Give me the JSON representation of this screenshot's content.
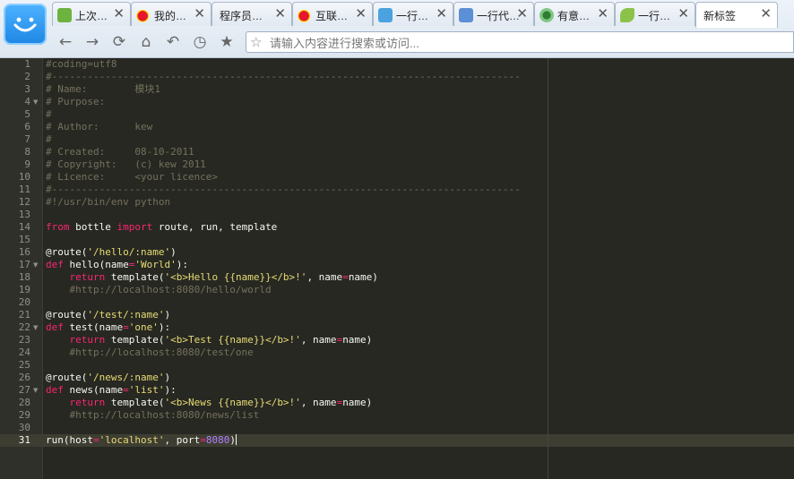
{
  "colors": {
    "keyword": "#f92672",
    "string": "#e6db74",
    "comment": "#75715e",
    "number": "#ae81ff",
    "plain": "#f8f8f2",
    "background": "#272822"
  },
  "browser": {
    "tabs": [
      {
        "label": "上次…",
        "icon": "history-icon",
        "active": false
      },
      {
        "label": "我的…",
        "icon": "weibo-icon",
        "active": false
      },
      {
        "label": "程序员…",
        "icon": "none",
        "active": false
      },
      {
        "label": "互联…",
        "icon": "weibo-icon",
        "active": false
      },
      {
        "label": "一行…",
        "icon": "b-icon",
        "active": false
      },
      {
        "label": "一行代…",
        "icon": "home-icon",
        "active": false
      },
      {
        "label": "有意…",
        "icon": "c-icon",
        "active": false
      },
      {
        "label": "一行…",
        "icon": "leaf-icon",
        "active": false
      },
      {
        "label": "新标签",
        "icon": "none",
        "active": true
      }
    ],
    "address_placeholder": "请输入内容进行搜索或访问..."
  },
  "editor": {
    "current_line": "31",
    "lines": [
      {
        "n": "1",
        "fold": false,
        "t": [
          [
            "c",
            "#coding=utf8"
          ]
        ]
      },
      {
        "n": "2",
        "fold": false,
        "t": [
          [
            "c",
            "#-------------------------------------------------------------------------------"
          ]
        ]
      },
      {
        "n": "3",
        "fold": false,
        "t": [
          [
            "c",
            "# Name:        模块1"
          ]
        ]
      },
      {
        "n": "4",
        "fold": true,
        "t": [
          [
            "c",
            "# Purpose:"
          ]
        ]
      },
      {
        "n": "5",
        "fold": false,
        "t": [
          [
            "c",
            "#"
          ]
        ]
      },
      {
        "n": "6",
        "fold": false,
        "t": [
          [
            "c",
            "# Author:      kew"
          ]
        ]
      },
      {
        "n": "7",
        "fold": false,
        "t": [
          [
            "c",
            "#"
          ]
        ]
      },
      {
        "n": "8",
        "fold": false,
        "t": [
          [
            "c",
            "# Created:     08-10-2011"
          ]
        ]
      },
      {
        "n": "9",
        "fold": false,
        "t": [
          [
            "c",
            "# Copyright:   (c) kew 2011"
          ]
        ]
      },
      {
        "n": "10",
        "fold": false,
        "t": [
          [
            "c",
            "# Licence:     <your licence>"
          ]
        ]
      },
      {
        "n": "11",
        "fold": false,
        "t": [
          [
            "c",
            "#-------------------------------------------------------------------------------"
          ]
        ]
      },
      {
        "n": "12",
        "fold": false,
        "t": [
          [
            "c",
            "#!/usr/bin/env python"
          ]
        ]
      },
      {
        "n": "13",
        "fold": false,
        "t": []
      },
      {
        "n": "14",
        "fold": false,
        "t": [
          [
            "k",
            "from"
          ],
          [
            "p",
            " bottle "
          ],
          [
            "k",
            "import"
          ],
          [
            "p",
            " route, run, template"
          ]
        ]
      },
      {
        "n": "15",
        "fold": false,
        "t": []
      },
      {
        "n": "16",
        "fold": false,
        "t": [
          [
            "p",
            "@route("
          ],
          [
            "s",
            "'/hello/:name'"
          ],
          [
            "p",
            ")"
          ]
        ]
      },
      {
        "n": "17",
        "fold": true,
        "t": [
          [
            "k",
            "def"
          ],
          [
            "p",
            " hello(name"
          ],
          [
            "k",
            "="
          ],
          [
            "s",
            "'World'"
          ],
          [
            "p",
            "):"
          ]
        ]
      },
      {
        "n": "18",
        "fold": false,
        "t": [
          [
            "p",
            "    "
          ],
          [
            "k",
            "return"
          ],
          [
            "p",
            " template("
          ],
          [
            "s",
            "'<b>Hello {{name}}</b>!'"
          ],
          [
            "p",
            ", name"
          ],
          [
            "k",
            "="
          ],
          [
            "p",
            "name)"
          ]
        ]
      },
      {
        "n": "19",
        "fold": false,
        "t": [
          [
            "p",
            "    "
          ],
          [
            "c",
            "#http://localhost:8080/hello/world"
          ]
        ]
      },
      {
        "n": "20",
        "fold": false,
        "t": []
      },
      {
        "n": "21",
        "fold": false,
        "t": [
          [
            "p",
            "@route("
          ],
          [
            "s",
            "'/test/:name'"
          ],
          [
            "p",
            ")"
          ]
        ]
      },
      {
        "n": "22",
        "fold": true,
        "t": [
          [
            "k",
            "def"
          ],
          [
            "p",
            " test(name"
          ],
          [
            "k",
            "="
          ],
          [
            "s",
            "'one'"
          ],
          [
            "p",
            "):"
          ]
        ]
      },
      {
        "n": "23",
        "fold": false,
        "t": [
          [
            "p",
            "    "
          ],
          [
            "k",
            "return"
          ],
          [
            "p",
            " template("
          ],
          [
            "s",
            "'<b>Test {{name}}</b>!'"
          ],
          [
            "p",
            ", name"
          ],
          [
            "k",
            "="
          ],
          [
            "p",
            "name)"
          ]
        ]
      },
      {
        "n": "24",
        "fold": false,
        "t": [
          [
            "p",
            "    "
          ],
          [
            "c",
            "#http://localhost:8080/test/one"
          ]
        ]
      },
      {
        "n": "25",
        "fold": false,
        "t": []
      },
      {
        "n": "26",
        "fold": false,
        "t": [
          [
            "p",
            "@route("
          ],
          [
            "s",
            "'/news/:name'"
          ],
          [
            "p",
            ")"
          ]
        ]
      },
      {
        "n": "27",
        "fold": true,
        "t": [
          [
            "k",
            "def"
          ],
          [
            "p",
            " news(name"
          ],
          [
            "k",
            "="
          ],
          [
            "s",
            "'list'"
          ],
          [
            "p",
            "):"
          ]
        ]
      },
      {
        "n": "28",
        "fold": false,
        "t": [
          [
            "p",
            "    "
          ],
          [
            "k",
            "return"
          ],
          [
            "p",
            " template("
          ],
          [
            "s",
            "'<b>News {{name}}</b>!'"
          ],
          [
            "p",
            ", name"
          ],
          [
            "k",
            "="
          ],
          [
            "p",
            "name)"
          ]
        ]
      },
      {
        "n": "29",
        "fold": false,
        "t": [
          [
            "p",
            "    "
          ],
          [
            "c",
            "#http://localhost:8080/news/list"
          ]
        ]
      },
      {
        "n": "30",
        "fold": false,
        "t": []
      },
      {
        "n": "31",
        "fold": false,
        "t": [
          [
            "p",
            "run(host"
          ],
          [
            "k",
            "="
          ],
          [
            "s",
            "'localhost'"
          ],
          [
            "p",
            ", port"
          ],
          [
            "k",
            "="
          ],
          [
            "n",
            "8080"
          ],
          [
            "p",
            ")"
          ]
        ]
      }
    ]
  }
}
